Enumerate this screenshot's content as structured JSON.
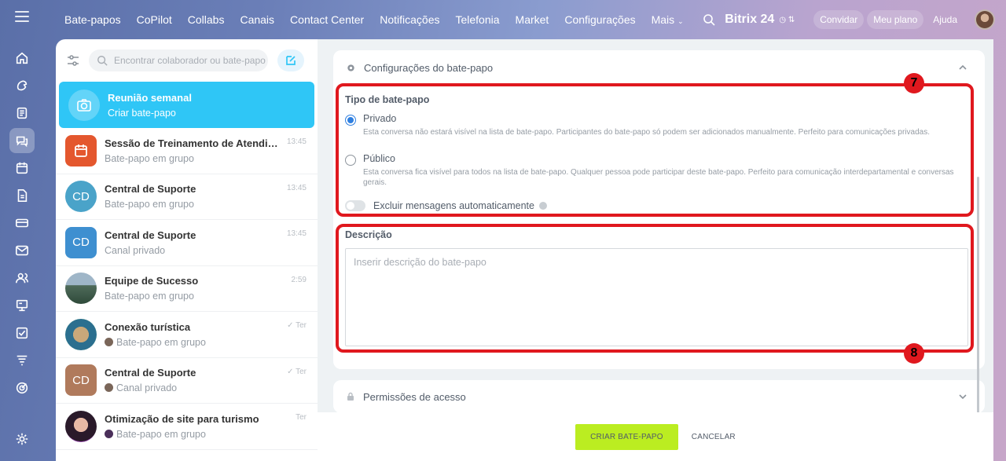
{
  "topbar": {
    "nav": [
      "Bate-papos",
      "CoPilot",
      "Collabs",
      "Canais",
      "Contact Center",
      "Notificações",
      "Telefonia",
      "Market",
      "Configurações",
      "Mais"
    ],
    "brand": "Bitrix 24",
    "invite": "Convidar",
    "plan": "Meu plano",
    "help": "Ajuda"
  },
  "sidebar_icons": [
    "home-icon",
    "feed-icon",
    "tasks-icon",
    "chat-icon",
    "calendar-icon",
    "docs-icon",
    "crm-icon",
    "mail-icon",
    "contacts-icon",
    "presentation-icon",
    "checklist-icon",
    "filter-icon",
    "target-icon",
    "settings-icon"
  ],
  "chatlist": {
    "search_placeholder": "Encontrar colaborador ou bate-papo",
    "items": [
      {
        "title": "Reunião semanal",
        "sub": "Criar bate-papo",
        "time": "",
        "avatar": "camera-icon",
        "color": "#2fc6f6"
      },
      {
        "title": "Sessão de Treinamento de Atendimento",
        "sub": "Bate-papo em grupo",
        "time": "13:45",
        "avatar": "calendar-icon",
        "color": "#e4572e"
      },
      {
        "title": "Central de Suporte",
        "sub": "Bate-papo em grupo",
        "time": "13:45",
        "avatar": "CD",
        "color": "#4aa3c9"
      },
      {
        "title": "Central de Suporte",
        "sub": "Canal privado",
        "time": "13:45",
        "avatar": "CD",
        "color": "#3e8fd0"
      },
      {
        "title": "Equipe de Sucesso",
        "sub": "Bate-papo em grupo",
        "time": "2:59",
        "avatar": "landscape-photo",
        "color": "#6b8fa8"
      },
      {
        "title": "Conexão turística",
        "sub": "Bate-papo em grupo",
        "time": "Ter",
        "avatar": "badge-photo",
        "color": "#3bb44a"
      },
      {
        "title": "Central de Suporte",
        "sub": "Canal privado",
        "time": "Ter",
        "avatar": "CD",
        "color": "#b07a5c"
      },
      {
        "title": "Otimização de site para turismo",
        "sub": "Bate-papo em grupo",
        "time": "Ter",
        "avatar": "portrait-photo",
        "color": "#5a3a7a"
      }
    ]
  },
  "settings": {
    "header": "Configurações do bate-papo",
    "type_title": "Tipo de bate-papo",
    "private_label": "Privado",
    "private_desc": "Esta conversa não estará visível na lista de bate-papo. Participantes do bate-papo só podem ser adicionados manualmente. Perfeito para comunicações privadas.",
    "public_label": "Público",
    "public_desc": "Esta conversa fica visível para todos na lista de bate-papo. Qualquer pessoa pode participar deste bate-papo. Perfeito para comunicação interdepartamental e conversas gerais.",
    "auto_delete": "Excluir mensagens automaticamente",
    "desc_title": "Descrição",
    "desc_placeholder": "Inserir descrição do bate-papo",
    "permissions": "Permissões de acesso"
  },
  "footer": {
    "create": "CRIAR BATE-PAPO",
    "cancel": "CANCELAR"
  },
  "annotations": [
    "7",
    "8"
  ],
  "colors": {
    "accent": "#2fc6f6",
    "create_button": "#bbed21",
    "highlight": "#e0181e"
  }
}
